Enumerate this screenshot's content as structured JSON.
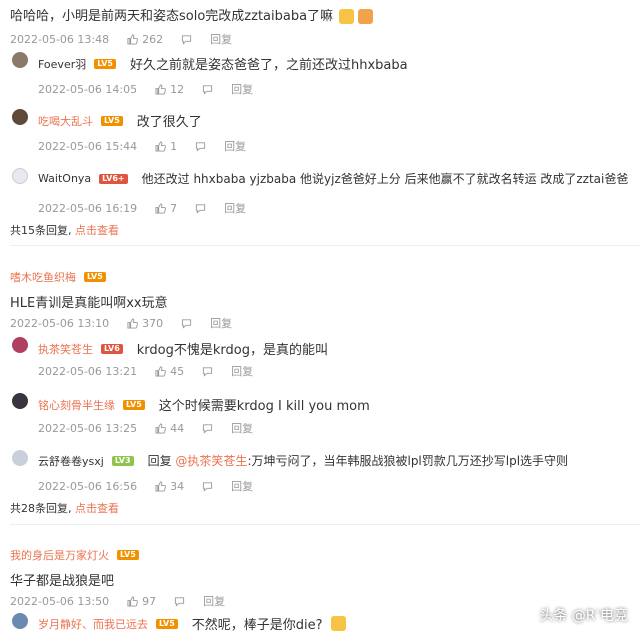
{
  "thread1": {
    "top": {
      "text": "哈哈哈，小明是前两天和姿态solo完改成zztaibaba了嘛",
      "time": "2022-05-06 13:48",
      "likes": "262",
      "reply": "回复"
    },
    "replies": [
      {
        "name": "Foever羽",
        "level": "LV5",
        "text": "好久之前就是姿态爸爸了，之前还改过hhxbaba",
        "time": "2022-05-06 14:05",
        "likes": "12",
        "reply": "回复"
      },
      {
        "name": "吃喝大乱斗",
        "level": "LV5",
        "text": "改了很久了",
        "time": "2022-05-06 15:44",
        "likes": "1",
        "reply": "回复"
      },
      {
        "name": "WaitOnya",
        "level": "LV6+",
        "text": "他还改过 hhxbaba yjzbaba 他说yjz爸爸好上分 后来他赢不了就改名转运 改成了zztai爸爸",
        "time": "2022-05-06 16:19",
        "likes": "7",
        "reply": "回复"
      }
    ],
    "more": {
      "prefix": "共",
      "count": "15",
      "suffix": "条回复,",
      "link": "点击查看"
    }
  },
  "thread2": {
    "top": {
      "name": "嗜木吃鱼织梅",
      "level": "LV5",
      "text": "HLE青训是真能叫啊xx玩意",
      "time": "2022-05-06 13:10",
      "likes": "370",
      "reply": "回复"
    },
    "replies": [
      {
        "name": "执茶笑苍生",
        "level": "LV6",
        "text": "krdog不愧是krdog，是真的能叫",
        "time": "2022-05-06 13:21",
        "likes": "45",
        "reply": "回复"
      },
      {
        "name": "铭心刻骨半生缘",
        "level": "LV5",
        "text": "这个时候需要krdog I kill you mom",
        "time": "2022-05-06 13:25",
        "likes": "44",
        "reply": "回复"
      },
      {
        "name": "云舒卷卷ysxj",
        "level": "LV3",
        "reply_prefix": "回复",
        "mention": "@执茶笑苍生",
        "text": ":万坤亏闷了，当年韩服战狼被lpl罚款几万还抄写lpl选手守则",
        "time": "2022-05-06 16:56",
        "likes": "34",
        "reply": "回复"
      }
    ],
    "more": {
      "prefix": "共",
      "count": "28",
      "suffix": "条回复,",
      "link": "点击查看"
    }
  },
  "thread3": {
    "top": {
      "name": "我的身后是万家灯火",
      "level": "LV5",
      "text": "华子都是战狼是吧",
      "time": "2022-05-06 13:50",
      "likes": "97",
      "reply": "回复"
    },
    "replies": [
      {
        "name": "岁月静好、而我已远去",
        "level": "LV5",
        "text": "不然呢，棒子是你die?"
      }
    ]
  },
  "watermark": "头条 @R‘电竞",
  "colors": {
    "accent": "#eb7350",
    "level_orange": "#f29100",
    "level_red": "#e0553d",
    "level_green": "#8fc34e",
    "meta_gray": "#999999"
  },
  "icons": [
    "like-icon",
    "comment-icon",
    "cat-emoji-icon",
    "avatar"
  ]
}
